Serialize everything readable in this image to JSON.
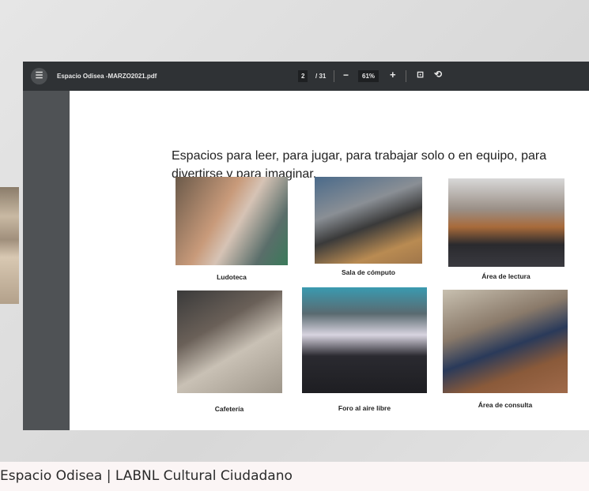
{
  "viewer": {
    "file_name": "Espacio Odisea -MARZO2021.pdf",
    "current_page": "2",
    "total_pages": "/ 31",
    "zoom": "61%",
    "minus": "−",
    "plus": "+",
    "menu_icon": "☰",
    "fit_icon": "⊡",
    "rotate_icon": "⟲"
  },
  "document": {
    "heading": "Espacios para leer, para jugar, para trabajar solo o en equipo, para divertirse y para imaginar.",
    "photos": [
      {
        "label": "Ludoteca"
      },
      {
        "label": "Sala de cómputo"
      },
      {
        "label": "Área de lectura"
      },
      {
        "label": "Cafetería"
      },
      {
        "label": "Foro al aire libre"
      },
      {
        "label": "Área de consulta"
      }
    ]
  },
  "caption": "Espacio Odisea | LABNL Cultural Ciudadano"
}
